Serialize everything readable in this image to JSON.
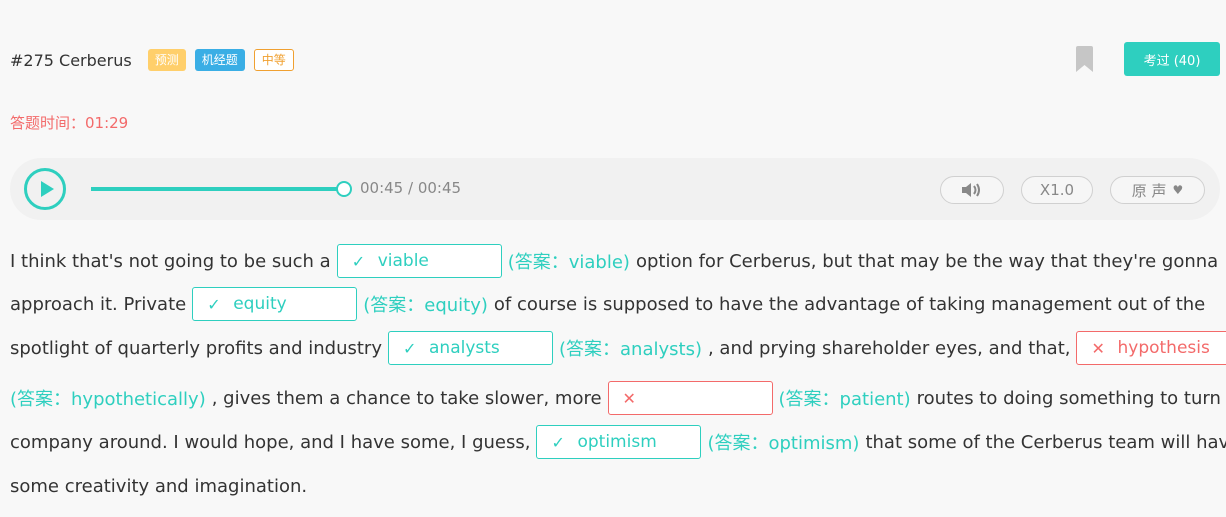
{
  "header": {
    "title": "#275 Cerberus",
    "tags": [
      "预测",
      "机经题",
      "中等"
    ],
    "passed_button": "考过 (40)"
  },
  "timer": "答题时间：01:29",
  "player": {
    "time": "00:45 / 00:45",
    "speed": "X1.0",
    "voice": "原 声",
    "progress": 1.0
  },
  "passage": {
    "l1": {
      "pre": "I think that's not going to be such a",
      "b1": "viable",
      "a1": "(答案：viable)",
      "post": "option for Cerberus, but that may be the way that they're gonna"
    },
    "l2": {
      "pre": "approach it. Private",
      "b2": "equity",
      "a2": "(答案：equity)",
      "post": "of course is supposed to have the advantage of taking management out of the"
    },
    "l3": {
      "pre": "spotlight of quarterly profits and industry",
      "b3": "analysts",
      "a3": "(答案：analysts)",
      "mid": ", and prying shareholder eyes, and that,",
      "b4": "hypothesis"
    },
    "l4": {
      "a4": "(答案：hypothetically)",
      "mid": ", gives them a chance to take slower, more",
      "b5": "",
      "a5": "(答案：patient)",
      "post": "routes to doing something to turn a"
    },
    "l5": {
      "pre": "company around. I would hope, and I have some, I guess,",
      "b6": "optimism",
      "a6": "(答案：optimism)",
      "post": "that some of the Cerberus team will have"
    },
    "l6": {
      "pre": "some creativity and imagination."
    }
  },
  "marks": {
    "correct": "✓",
    "wrong": "✕"
  },
  "colors": {
    "accent": "#2ecfbf",
    "error": "#f36a6a",
    "tag_yellow": "#ffcf6b",
    "tag_blue": "#3aaee5",
    "tag_orange": "#f0a030"
  },
  "icons": [
    "bookmark-icon",
    "play-icon",
    "volume-icon",
    "heart-icon",
    "check-icon",
    "cross-icon"
  ]
}
